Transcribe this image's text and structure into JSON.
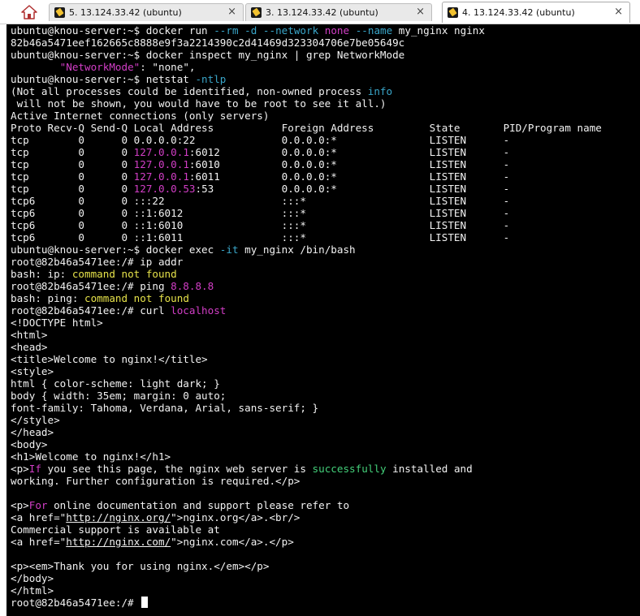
{
  "tabs": [
    {
      "title": "5. 13.124.33.42 (ubuntu)",
      "active": false
    },
    {
      "title": "3. 13.124.33.42 (ubuntu)",
      "active": false
    },
    {
      "title": "4. 13.124.33.42 (ubuntu)",
      "active": true
    }
  ],
  "home_icon": "home-icon",
  "tab_icon": "terminal-icon",
  "close_glyph": "×",
  "colors": {
    "background": "#000000",
    "text": "#f2f2f2",
    "cyan": "#3aa6c9",
    "magenta": "#d23ec6",
    "yellow": "#e6e24a",
    "green": "#44d07a"
  },
  "terminal_lines": [
    [
      [
        "default",
        "ubuntu@knou-server:~$ docker run "
      ],
      [
        "cyan",
        "--rm"
      ],
      [
        "default",
        " "
      ],
      [
        "cyan",
        "-d"
      ],
      [
        "default",
        " "
      ],
      [
        "cyan",
        "--network"
      ],
      [
        "default",
        " "
      ],
      [
        "magenta",
        "none"
      ],
      [
        "default",
        " "
      ],
      [
        "cyan",
        "--name"
      ],
      [
        "default",
        " my_nginx nginx"
      ]
    ],
    [
      [
        "default",
        "82b46a5471eef162665c8888e9f3a2214390c2d41469d323304706e7be05649c"
      ]
    ],
    [
      [
        "default",
        "ubuntu@knou-server:~$ docker inspect my_nginx | grep NetworkMode"
      ]
    ],
    [
      [
        "default",
        "        "
      ],
      [
        "pink",
        "\"NetworkMode\""
      ],
      [
        "default",
        ": \"none\","
      ]
    ],
    [
      [
        "default",
        "ubuntu@knou-server:~$ netstat "
      ],
      [
        "cyan",
        "-ntlp"
      ]
    ],
    [
      [
        "default",
        "(Not all processes could be identified, non-owned process "
      ],
      [
        "cyan",
        "info"
      ]
    ],
    [
      [
        "default",
        " will not be shown, you would have to be root to see it all.)"
      ]
    ],
    [
      [
        "default",
        "Active Internet connections (only servers)"
      ]
    ],
    [
      [
        "default",
        "Proto Recv-Q Send-Q Local Address           Foreign Address         State       PID/Program name"
      ]
    ],
    [
      [
        "default",
        "tcp        0      0 0.0.0.0:22              0.0.0.0:*               LISTEN      -"
      ]
    ],
    [
      [
        "default",
        "tcp        0      0 "
      ],
      [
        "magenta",
        "127.0.0.1"
      ],
      [
        "default",
        ":6012          0.0.0.0:*               LISTEN      -"
      ]
    ],
    [
      [
        "default",
        "tcp        0      0 "
      ],
      [
        "magenta",
        "127.0.0.1"
      ],
      [
        "default",
        ":6010          0.0.0.0:*               LISTEN      -"
      ]
    ],
    [
      [
        "default",
        "tcp        0      0 "
      ],
      [
        "magenta",
        "127.0.0.1"
      ],
      [
        "default",
        ":6011          0.0.0.0:*               LISTEN      -"
      ]
    ],
    [
      [
        "default",
        "tcp        0      0 "
      ],
      [
        "magenta",
        "127.0.0.53"
      ],
      [
        "default",
        ":53           0.0.0.0:*               LISTEN      -"
      ]
    ],
    [
      [
        "default",
        "tcp6       0      0 :::22                   :::*                    LISTEN      -"
      ]
    ],
    [
      [
        "default",
        "tcp6       0      0 ::1:6012                :::*                    LISTEN      -"
      ]
    ],
    [
      [
        "default",
        "tcp6       0      0 ::1:6010                :::*                    LISTEN      -"
      ]
    ],
    [
      [
        "default",
        "tcp6       0      0 ::1:6011                :::*                    LISTEN      -"
      ]
    ],
    [
      [
        "default",
        "ubuntu@knou-server:~$ docker exec "
      ],
      [
        "cyan",
        "-it"
      ],
      [
        "default",
        " my_nginx /bin/bash"
      ]
    ],
    [
      [
        "default",
        "root@82b46a5471ee:/# ip addr"
      ]
    ],
    [
      [
        "default",
        "bash: ip: "
      ],
      [
        "yellow",
        "command not found"
      ]
    ],
    [
      [
        "default",
        "root@82b46a5471ee:/# ping "
      ],
      [
        "magenta",
        "8.8.8.8"
      ]
    ],
    [
      [
        "default",
        "bash: ping: "
      ],
      [
        "yellow",
        "command not found"
      ]
    ],
    [
      [
        "default",
        "root@82b46a5471ee:/# curl "
      ],
      [
        "magenta",
        "localhost"
      ]
    ],
    [
      [
        "default",
        "<!DOCTYPE html>"
      ]
    ],
    [
      [
        "default",
        "<html>"
      ]
    ],
    [
      [
        "default",
        "<head>"
      ]
    ],
    [
      [
        "default",
        "<title>Welcome to nginx!</title>"
      ]
    ],
    [
      [
        "default",
        "<style>"
      ]
    ],
    [
      [
        "default",
        "html { color-scheme: light dark; }"
      ]
    ],
    [
      [
        "default",
        "body { width: 35em; margin: 0 auto;"
      ]
    ],
    [
      [
        "default",
        "font-family: Tahoma, Verdana, Arial, sans-serif; }"
      ]
    ],
    [
      [
        "default",
        "</style>"
      ]
    ],
    [
      [
        "default",
        "</head>"
      ]
    ],
    [
      [
        "default",
        "<body>"
      ]
    ],
    [
      [
        "default",
        "<h1>Welcome to nginx!</h1>"
      ]
    ],
    [
      [
        "default",
        "<p>"
      ],
      [
        "magenta",
        "If"
      ],
      [
        "default",
        " you see this page, the nginx web server is "
      ],
      [
        "green",
        "successfully"
      ],
      [
        "default",
        " installed and"
      ]
    ],
    [
      [
        "default",
        "working. Further configuration is required.</p>"
      ]
    ],
    [
      [
        "default",
        ""
      ]
    ],
    [
      [
        "default",
        "<p>"
      ],
      [
        "magenta",
        "For"
      ],
      [
        "default",
        " online documentation and support please refer to"
      ]
    ],
    [
      [
        "default",
        "<a href=\""
      ],
      [
        "underline",
        "http://nginx.org/"
      ],
      [
        "default",
        "\">nginx.org</a>.<br/>"
      ]
    ],
    [
      [
        "default",
        "Commercial support is available at"
      ]
    ],
    [
      [
        "default",
        "<a href=\""
      ],
      [
        "underline",
        "http://nginx.com/"
      ],
      [
        "default",
        "\">nginx.com</a>.</p>"
      ]
    ],
    [
      [
        "default",
        ""
      ]
    ],
    [
      [
        "default",
        "<p><em>Thank you for using nginx.</em></p>"
      ]
    ],
    [
      [
        "default",
        "</body>"
      ]
    ],
    [
      [
        "default",
        "</html>"
      ]
    ],
    [
      [
        "default",
        "root@82b46a5471ee:/# "
      ]
    ]
  ]
}
